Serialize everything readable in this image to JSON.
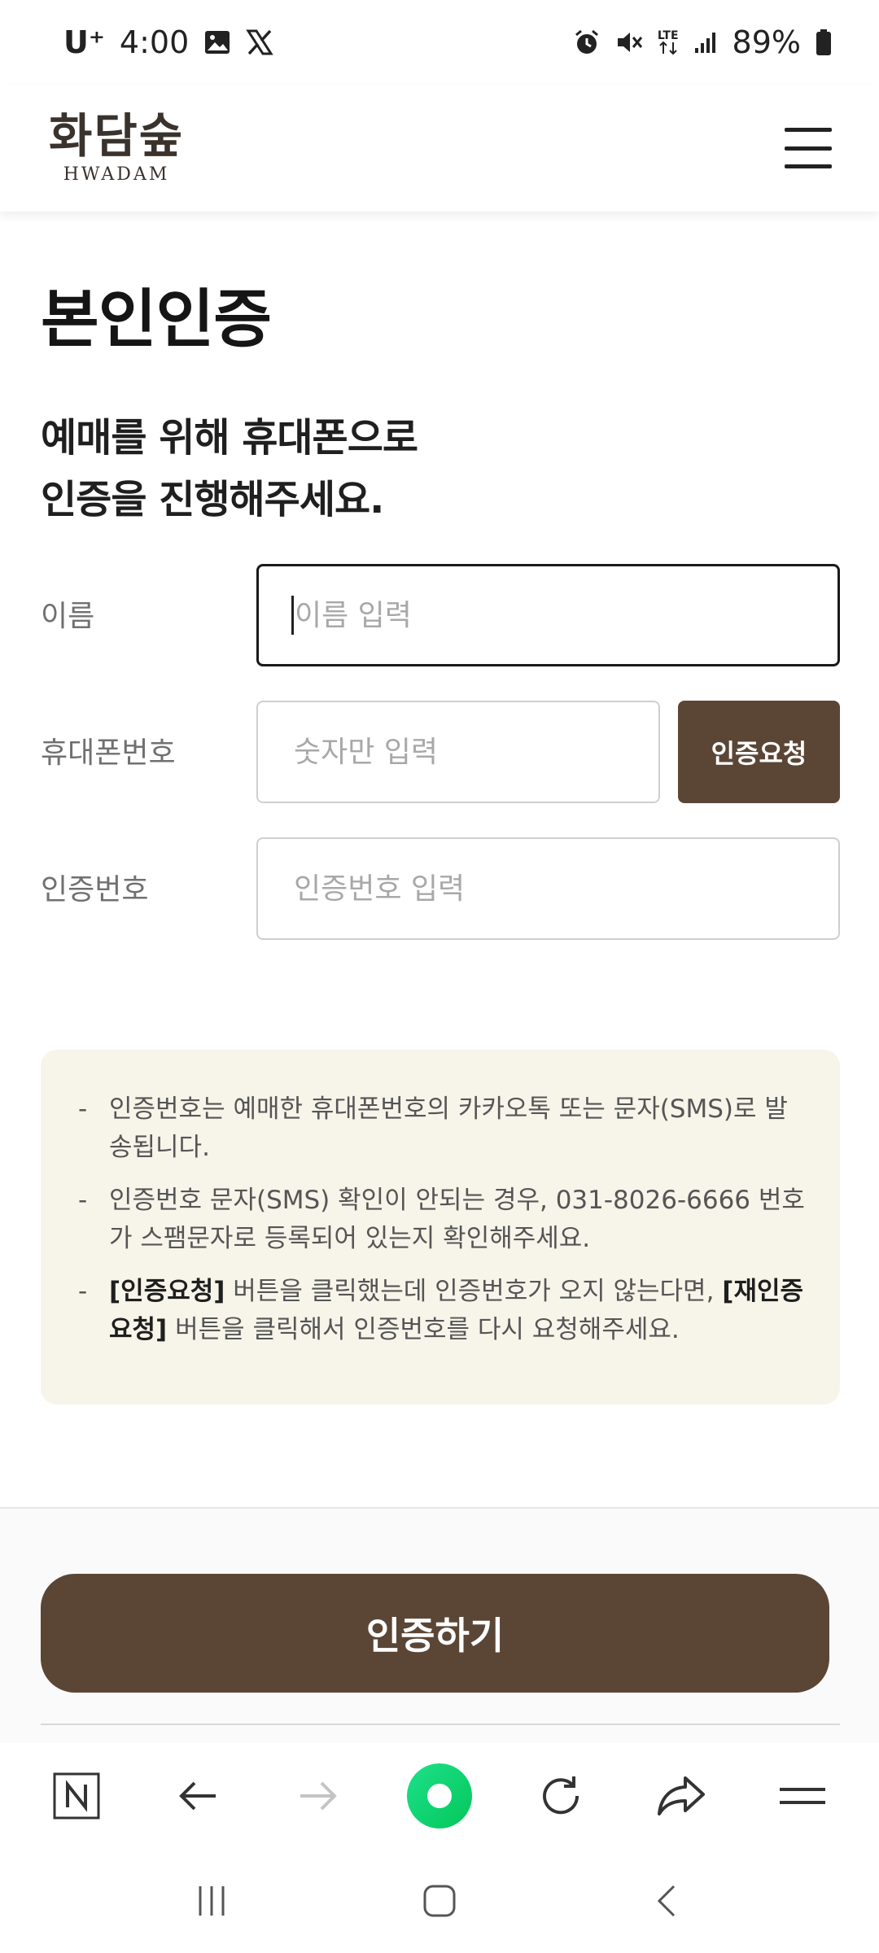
{
  "status_bar": {
    "carrier": "U⁺",
    "time": "4:00",
    "network": "LTE",
    "battery": "89%"
  },
  "header": {
    "logo_kr": "화담숲",
    "logo_en": "HWADAM"
  },
  "page": {
    "title": "본인인증",
    "subtitle_line1": "예매를 위해 휴대폰으로",
    "subtitle_line2": "인증을 진행해주세요."
  },
  "form": {
    "name_label": "이름",
    "name_placeholder": "이름 입력",
    "phone_label": "휴대폰번호",
    "phone_placeholder": "숫자만 입력",
    "request_button": "인증요청",
    "code_label": "인증번호",
    "code_placeholder": "인증번호 입력"
  },
  "notice": {
    "dash": "-",
    "item1": "인증번호는 예매한 휴대폰번호의 카카오톡 또는 문자(SMS)로 발송됩니다.",
    "item2": "인증번호 문자(SMS) 확인이 안되는 경우, 031-8026-6666 번호가 스팸문자로 등록되어 있는지 확인해주세요.",
    "item3_bold1": "[인증요청]",
    "item3_mid": " 버튼을 클릭했는데 인증번호가 오지 않는다면, ",
    "item3_bold2": "[재인증요청]",
    "item3_end": " 버튼을 클릭해서 인증번호를 다시 요청해주세요."
  },
  "footer": {
    "confirm_button": "인증하기"
  },
  "colors": {
    "brand_brown": "#5b4636",
    "notice_bg": "#f7f4ea",
    "naver_green": "#03c75a"
  },
  "icons": [
    "gallery-icon",
    "x-logo-icon",
    "alarm-icon",
    "mute-icon",
    "signal-icon",
    "battery-icon",
    "menu-icon",
    "naver-n-icon",
    "back-arrow-icon",
    "forward-arrow-icon",
    "home-dot-icon",
    "refresh-icon",
    "share-icon",
    "browser-menu-icon",
    "recent-apps-icon",
    "home-icon",
    "back-icon"
  ]
}
